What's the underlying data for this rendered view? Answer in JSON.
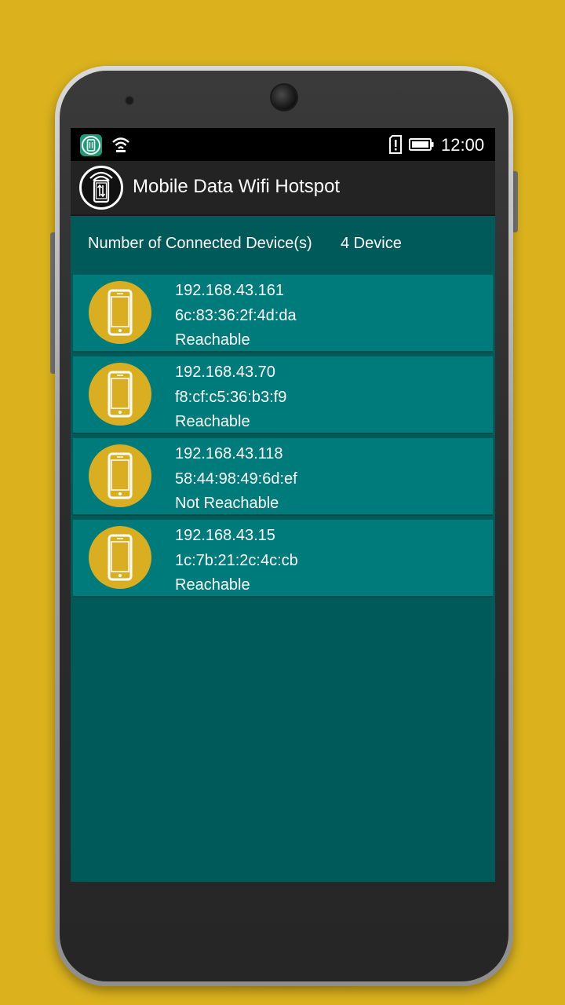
{
  "status_bar": {
    "time": "12:00",
    "icons": [
      "app-notification-icon",
      "wifi-icon",
      "sim-alert-icon",
      "battery-icon"
    ]
  },
  "app_bar": {
    "title": "Mobile Data Wifi Hotspot",
    "logo_icon": "hotspot-logo-icon"
  },
  "summary": {
    "label": "Number of Connected Device(s)",
    "value": "4 Device"
  },
  "devices": [
    {
      "ip": "192.168.43.161",
      "mac": "6c:83:36:2f:4d:da",
      "status": "Reachable"
    },
    {
      "ip": "192.168.43.70",
      "mac": "f8:cf:c5:36:b3:f9",
      "status": "Reachable"
    },
    {
      "ip": "192.168.43.118",
      "mac": "58:44:98:49:6d:ef",
      "status": "Not Reachable"
    },
    {
      "ip": "192.168.43.15",
      "mac": "1c:7b:21:2c:4c:cb",
      "status": "Reachable"
    }
  ],
  "colors": {
    "background": "#DBB21D",
    "screen": "#005A5A",
    "row": "#007B7B",
    "icon_circle": "#D9AF21",
    "app_bar": "#232323"
  }
}
